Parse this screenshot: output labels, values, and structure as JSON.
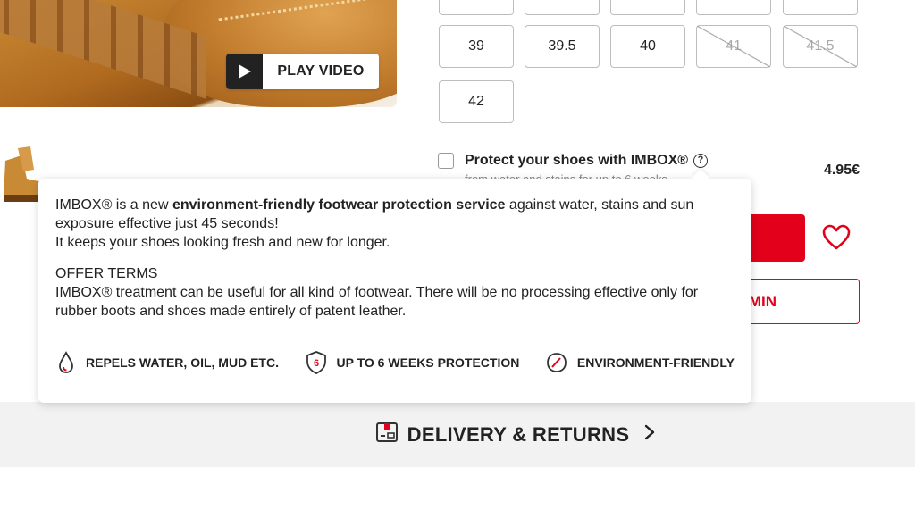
{
  "hero": {
    "play_label": "PLAY VIDEO"
  },
  "sizes": {
    "row_partial": [
      "",
      "",
      "",
      "",
      ""
    ],
    "row2": [
      {
        "label": "39",
        "available": true
      },
      {
        "label": "39.5",
        "available": true
      },
      {
        "label": "40",
        "available": true
      },
      {
        "label": "41",
        "available": false
      },
      {
        "label": "41.5",
        "available": false
      }
    ],
    "row3": [
      {
        "label": "42",
        "available": true
      }
    ]
  },
  "imbox": {
    "title": "Protect your shoes with IMBOX®",
    "subtitle": "from water and stains for up to 6 weeks",
    "price": "4.95€",
    "help_symbol": "?"
  },
  "actions": {
    "secondary_label_visible": "MIN"
  },
  "popover": {
    "p1_a": "IMBOX® is a new ",
    "p1_b": "environment-friendly footwear protection service",
    "p1_c": " against water, stains and sun exposure effective just 45 seconds!",
    "p2": "It keeps your shoes looking fresh and new for longer.",
    "terms_heading": "OFFER TERMS",
    "terms_body": "IMBOX® treatment can be useful for all kind of footwear. There will be no processing effective only for rubber boots and shoes made entirely of patent leather.",
    "features": [
      {
        "icon": "water-drop-icon",
        "label": "REPELS WATER, OIL, MUD ETC."
      },
      {
        "icon": "shield-6-icon",
        "label": "UP TO 6 WEEKS PROTECTION",
        "badge": "6"
      },
      {
        "icon": "leaf-icon",
        "label": "ENVIRONMENT-FRIENDLY"
      }
    ]
  },
  "delivery": {
    "label": "DELIVERY & RETURNS"
  },
  "colors": {
    "brand_red": "#e2001a",
    "bar_bg": "#f2f2f2"
  }
}
